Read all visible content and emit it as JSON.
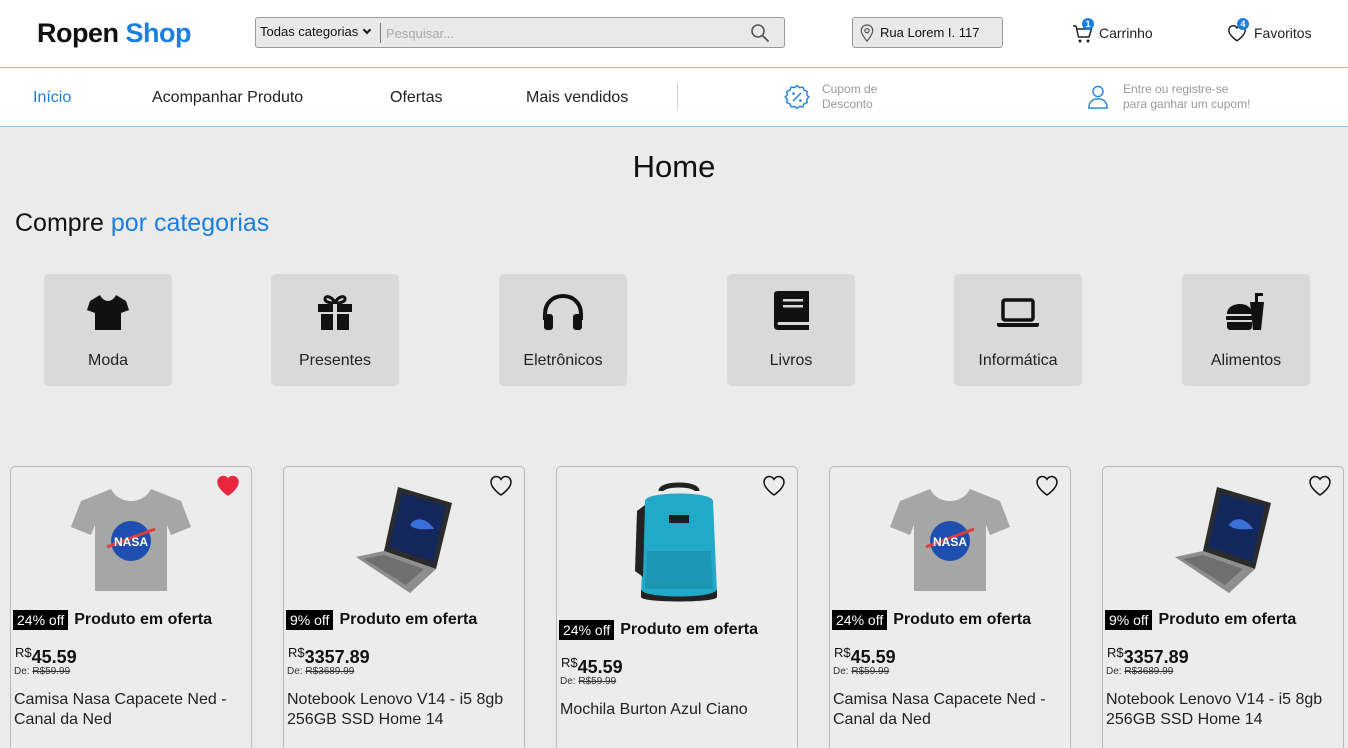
{
  "header": {
    "logo_part1": "Ropen",
    "logo_part2": "Shop",
    "search": {
      "category": "Todas categorias",
      "placeholder": "Pesquisar..."
    },
    "address": "Rua Lorem I. 117",
    "cart": {
      "label": "Carrinho",
      "count": "1"
    },
    "favorites": {
      "label": "Favoritos",
      "count": "4"
    }
  },
  "nav": {
    "items": [
      "Início",
      "Acompanhar Produto",
      "Ofertas",
      "Mais vendidos"
    ],
    "coupon_line1": "Cupom de",
    "coupon_line2": "Desconto",
    "login_line1": "Entre ou registre-se",
    "login_line2": "para ganhar um cupom!"
  },
  "page_title": "Home",
  "section": {
    "title_plain": "Compre",
    "title_accent": "por categorias"
  },
  "categories": [
    {
      "label": "Moda",
      "icon": "tshirt-icon"
    },
    {
      "label": "Presentes",
      "icon": "gift-icon"
    },
    {
      "label": "Eletrônicos",
      "icon": "headphones-icon"
    },
    {
      "label": "Livros",
      "icon": "book-icon"
    },
    {
      "label": "Informática",
      "icon": "laptop-icon"
    },
    {
      "label": "Alimentos",
      "icon": "burger-drink-icon"
    }
  ],
  "products": [
    {
      "image": "tshirt-nasa",
      "favorited": true,
      "discount": "24% off",
      "offer_label": "Produto em oferta",
      "currency": "R$",
      "price": "45.59",
      "old_price_prefix": "De:",
      "old_price": "R$59.99",
      "name": "Camisa Nasa Capacete Ned - Canal da Ned"
    },
    {
      "image": "laptop",
      "favorited": false,
      "discount": "9% off",
      "offer_label": "Produto em oferta",
      "currency": "R$",
      "price": "3357.89",
      "old_price_prefix": "De:",
      "old_price": "R$3689.99",
      "name": "Notebook Lenovo V14 - i5 8gb 256GB SSD Home 14"
    },
    {
      "image": "backpack",
      "favorited": false,
      "discount": "24% off",
      "offer_label": "Produto em oferta",
      "currency": "R$",
      "price": "45.59",
      "old_price_prefix": "De:",
      "old_price": "R$59.99",
      "name": "Mochila Burton Azul Ciano"
    },
    {
      "image": "tshirt-nasa",
      "favorited": false,
      "discount": "24% off",
      "offer_label": "Produto em oferta",
      "currency": "R$",
      "price": "45.59",
      "old_price_prefix": "De:",
      "old_price": "R$59.99",
      "name": "Camisa Nasa Capacete Ned - Canal da Ned"
    },
    {
      "image": "laptop",
      "favorited": false,
      "discount": "9% off",
      "offer_label": "Produto em oferta",
      "currency": "R$",
      "price": "3357.89",
      "old_price_prefix": "De:",
      "old_price": "R$3689.99",
      "name": "Notebook Lenovo V14 - i5 8gb 256GB SSD Home 14"
    }
  ],
  "colors": {
    "accent": "#1a7fe0",
    "heart_active": "#e8273f",
    "background": "#ebebeb"
  }
}
